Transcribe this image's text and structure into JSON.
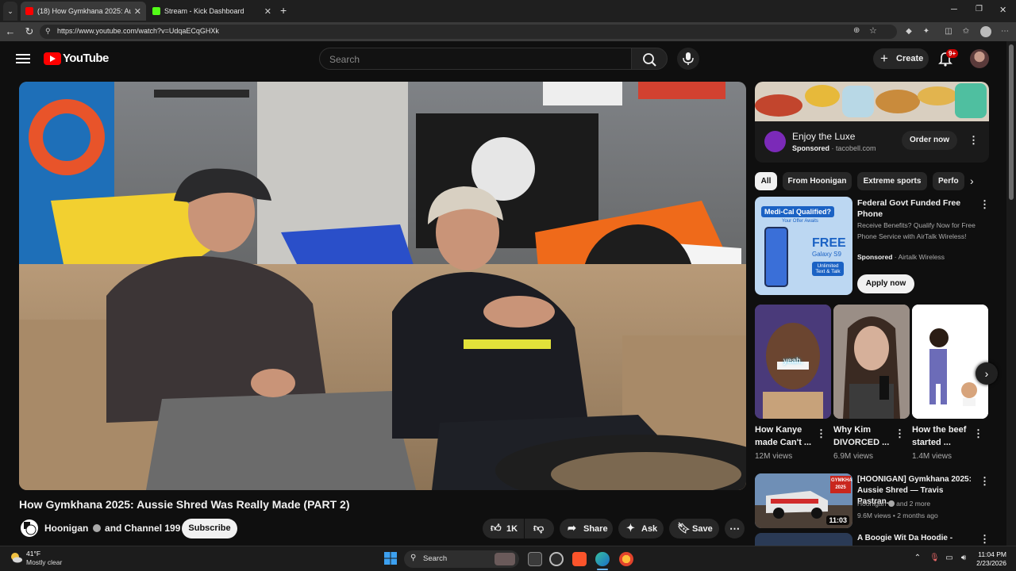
{
  "browser": {
    "tabs": [
      {
        "label": "(18) How Gymkhana 2025: Aussie",
        "favicon": "youtube-icon",
        "active": true
      },
      {
        "label": "Stream - Kick Dashboard",
        "favicon": "kick-icon",
        "active": false
      }
    ],
    "url": "https://www.youtube.com/watch?v=UdqaECqGHXk"
  },
  "header": {
    "logo_text": "YouTube",
    "search_placeholder": "Search",
    "create_label": "Create",
    "notification_count": "9+"
  },
  "video": {
    "title": "How Gymkhana 2025: Aussie Shred Was Really Made (PART 2)",
    "channel": "Hoonigan",
    "collab": "and Channel 199",
    "subscribe_label": "Subscribe",
    "likes": "1K",
    "share_label": "Share",
    "ask_label": "Ask",
    "save_label": "Save"
  },
  "ad": {
    "title": "Enjoy the Luxe",
    "sponsored": "Sponsored",
    "domain": "tacobell.com",
    "cta": "Order now"
  },
  "chips": [
    "All",
    "From Hoonigan",
    "Extreme sports",
    "Perfo"
  ],
  "sponsored_item": {
    "thumb_heading": "Medi-Cal Qualified?",
    "thumb_sub": "Your Offer Awaits",
    "thumb_free": "FREE",
    "thumb_phone": "Galaxy S9",
    "thumb_plus": "Unlimited Text & Talk",
    "title": "Federal Govt Funded Free Phone",
    "description": "Receive Benefits? Qualify Now for Free Phone Service with AirTalk Wireless!",
    "sponsored": "Sponsored",
    "advertiser": "Airtalk Wireless",
    "cta": "Apply now"
  },
  "shorts": [
    {
      "title": "How Kanye made Can't ...",
      "views": "12M views",
      "overlay": "yeah,"
    },
    {
      "title": "Why Kim DIVORCED ...",
      "views": "6.9M views"
    },
    {
      "title": "How the beef started ...",
      "views": "1.4M views"
    }
  ],
  "related": [
    {
      "title": "[HOONIGAN] Gymkhana 2025: Aussie Shred — Travis Pastran...",
      "channel": "Hoonigan",
      "channel_suffix": "and 2 more",
      "views": "9.6M views",
      "age": "2 months ago",
      "duration": "11:03",
      "thumb_badge": "GYMKHANA 2025"
    },
    {
      "title": "A Boogie Wit Da Hoodie -"
    }
  ],
  "taskbar": {
    "temperature": "41°F",
    "weather": "Mostly clear",
    "search_label": "Search",
    "time": "11:04 PM",
    "date": "2/23/2026"
  },
  "colors": {
    "youtube_red": "#ff0000",
    "background": "#0f0f0f",
    "surface": "#272727",
    "kick_green": "#53fc18"
  }
}
